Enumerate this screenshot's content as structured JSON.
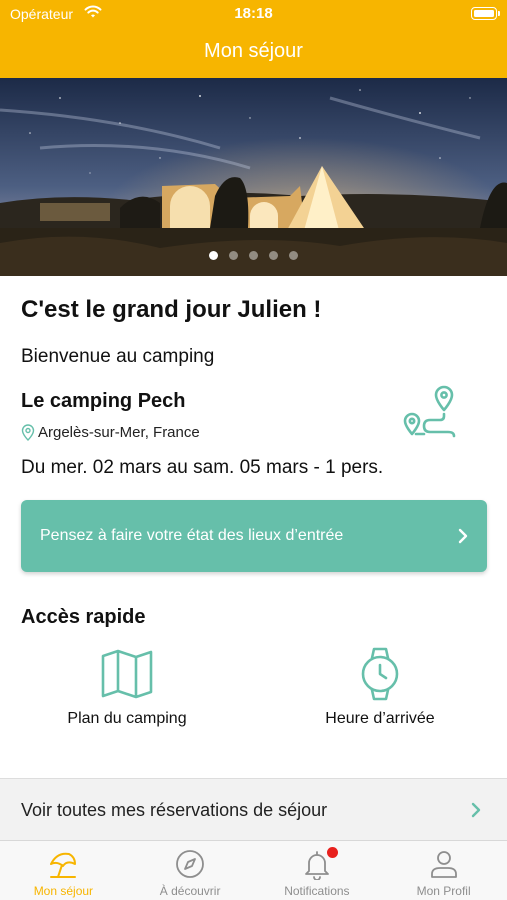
{
  "status_bar": {
    "carrier": "Opérateur",
    "time": "18:18"
  },
  "nav": {
    "title": "Mon séjour"
  },
  "hero": {
    "slide_count": 5,
    "active_slide": 1
  },
  "stay": {
    "heading": "C'est le grand jour Julien !",
    "welcome": "Bienvenue au camping",
    "camping_name": "Le camping Pech",
    "location": "Argelès-sur-Mer, France",
    "dates": "Du mer. 02 mars au sam. 05 mars - 1 pers."
  },
  "banner": {
    "text": "Pensez à faire votre état des lieux d’entrée"
  },
  "quick_access": {
    "title": "Accès rapide",
    "items": [
      {
        "label": "Plan du camping",
        "icon": "map-icon"
      },
      {
        "label": "Heure d’arrivée",
        "icon": "watch-icon"
      }
    ]
  },
  "reservations": {
    "text": "Voir toutes mes réservations de séjour"
  },
  "tabs": [
    {
      "label": "Mon séjour",
      "icon": "beach-umbrella-icon",
      "active": true
    },
    {
      "label": "À découvrir",
      "icon": "compass-icon",
      "active": false
    },
    {
      "label": "Notifications",
      "icon": "bell-icon",
      "active": false,
      "badge": true
    },
    {
      "label": "Mon Profil",
      "icon": "user-icon",
      "active": false
    }
  ],
  "colors": {
    "accent": "#F7B500",
    "teal": "#66BFAA",
    "badge": "#E8201D"
  }
}
